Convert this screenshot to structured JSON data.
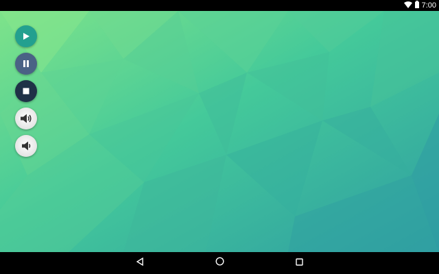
{
  "status_bar": {
    "time": "7:00",
    "icons": [
      "wifi-icon",
      "battery-icon"
    ]
  },
  "controls": {
    "buttons": [
      {
        "name": "play-button",
        "icon": "play-icon",
        "color": "#23A08F"
      },
      {
        "name": "pause-button",
        "icon": "pause-icon",
        "color": "#4A6285"
      },
      {
        "name": "stop-button",
        "icon": "stop-icon",
        "color": "#1F3147"
      },
      {
        "name": "volume-up-button",
        "icon": "volume-up-icon",
        "color": "#E6E6E6"
      },
      {
        "name": "volume-down-button",
        "icon": "volume-down-icon",
        "color": "#E6E6E6"
      }
    ]
  },
  "nav_bar": {
    "buttons": [
      "back-icon",
      "home-icon",
      "recents-icon"
    ]
  },
  "colors": {
    "wallpaper_light": "#7EE08A",
    "wallpaper_mid": "#3EC49B",
    "wallpaper_dark": "#2E9FA0"
  }
}
